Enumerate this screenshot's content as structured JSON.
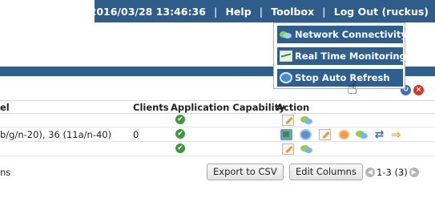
{
  "header": {
    "datetime": "2016/03/28 13:46:36",
    "help": "Help",
    "toolbox": "Toolbox",
    "logout": "Log Out (ruckus)",
    "separator": "|",
    "bar_color": "#2e5d8a"
  },
  "toolbox_menu": {
    "items": [
      {
        "label": "Network Connectivity",
        "icon": "network-connectivity-icon"
      },
      {
        "label": "Real Time Monitoring",
        "icon": "realtime-monitoring-icon"
      },
      {
        "label": "Stop Auto Refresh",
        "icon": "stop-auto-refresh-icon"
      }
    ],
    "item_color": "#2f5f8e"
  },
  "panel": {
    "refresh_glyph": "↻",
    "close_glyph": "×"
  },
  "table": {
    "headers": {
      "col1": "el",
      "clients": "Clients",
      "app_capability": "Application Capability",
      "action": "Action"
    },
    "rows": [
      {
        "col1": "",
        "clients": "",
        "check": "✔",
        "actions": [
          "edit-icon",
          "network-connectivity-icon"
        ]
      },
      {
        "col1": "b/g/n-20), 36 (11a/n-40)",
        "clients": "0",
        "check": "✔",
        "actions": [
          "speedflex-icon",
          "monitor-icon",
          "edit-icon",
          "spectrum-icon",
          "network-connectivity-icon",
          "restart-icon",
          "arrow-icon"
        ]
      },
      {
        "col1": "",
        "clients": "",
        "check": "✔",
        "actions": [
          "edit-icon",
          "network-connectivity-icon"
        ]
      }
    ]
  },
  "footer": {
    "left_text": "ns",
    "export_label": "Export to CSV",
    "edit_columns_label": "Edit Columns",
    "pager_text": "1-3 (3)",
    "prev_glyph": "◀",
    "next_glyph": "▶"
  }
}
